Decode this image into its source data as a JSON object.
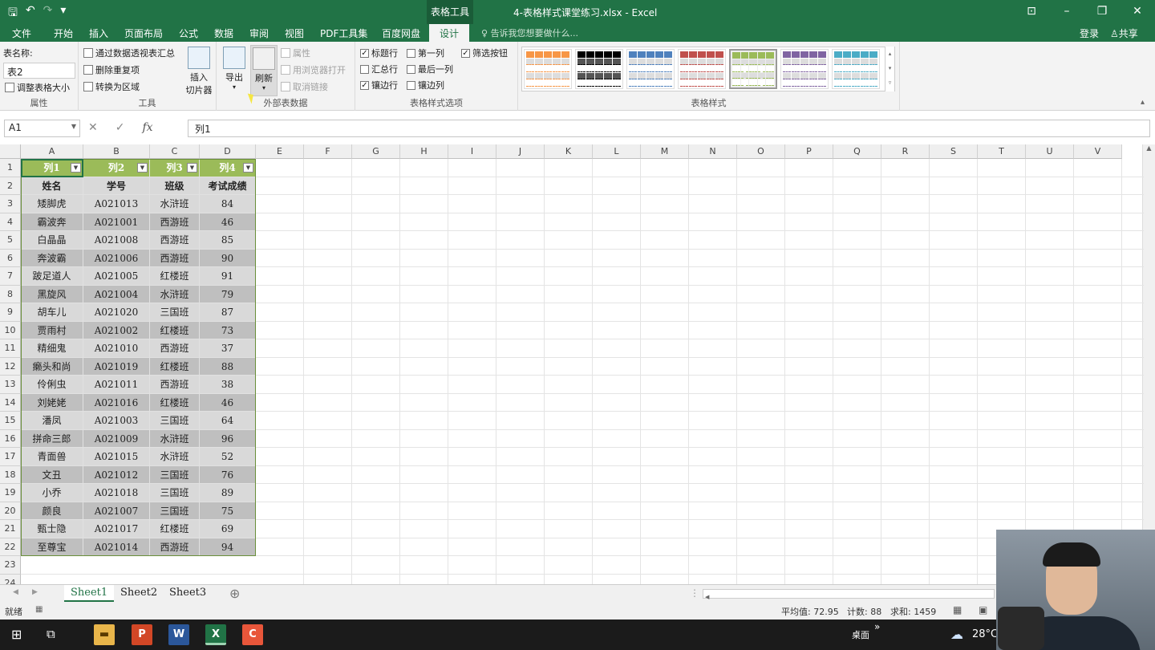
{
  "window": {
    "title": "4-表格样式课堂练习.xlsx - Excel",
    "context_tab_group": "表格工具",
    "qat_undo": "↶",
    "qat_redo": "↷",
    "win_buttons": [
      "⊡",
      "–",
      "❐",
      "✕"
    ]
  },
  "tabs": {
    "items": [
      "文件",
      "开始",
      "插入",
      "页面布局",
      "公式",
      "数据",
      "审阅",
      "视图",
      "PDF工具集",
      "百度网盘",
      "设计"
    ],
    "active": "设计",
    "tell_me": "告诉我您想要做什么...",
    "login": "登录",
    "share": "共享"
  },
  "ribbon": {
    "props": {
      "name_label": "表名称:",
      "name_value": "表2",
      "resize": "调整表格大小",
      "group": "属性"
    },
    "tools": {
      "pivot": "通过数据透视表汇总",
      "dedupe": "删除重复项",
      "convert": "转换为区域",
      "slicer_line1": "插入",
      "slicer_line2": "切片器",
      "group": "工具"
    },
    "external": {
      "export": "导出",
      "refresh": "刷新",
      "properties": "属性",
      "open_browser": "用浏览器打开",
      "unlink": "取消链接",
      "group": "外部表数据"
    },
    "style_options": {
      "header_row": "标题行",
      "total_row": "汇总行",
      "banded_rows": "镶边行",
      "first_col": "第一列",
      "last_col": "最后一列",
      "banded_cols": "镶边列",
      "filter_btn": "筛选按钮",
      "header_row_checked": true,
      "total_row_checked": false,
      "banded_rows_checked": true,
      "first_col_checked": false,
      "last_col_checked": false,
      "banded_cols_checked": false,
      "filter_btn_checked": true,
      "group": "表格样式选项"
    },
    "styles": {
      "group": "表格样式",
      "swatches": [
        "#f79646",
        "#000000",
        "#4f81bd",
        "#c0504d",
        "#9bbb59",
        "#8064a2",
        "#4bacc6"
      ],
      "selected_index": 4
    }
  },
  "formula_bar": {
    "name_box": "A1",
    "cancel": "✕",
    "enter": "✓",
    "fx": "fx",
    "content": "列1"
  },
  "sheet": {
    "columns": [
      "A",
      "B",
      "C",
      "D",
      "E",
      "F",
      "G",
      "H",
      "I",
      "J",
      "K",
      "L",
      "M",
      "N",
      "O",
      "P",
      "Q",
      "R",
      "S",
      "T",
      "U",
      "V"
    ],
    "row_numbers": [
      "1",
      "2",
      "3",
      "4",
      "5",
      "6",
      "7",
      "8",
      "9",
      "10",
      "11",
      "12",
      "13",
      "14",
      "15",
      "16",
      "17",
      "18",
      "19",
      "20",
      "21",
      "22",
      "23",
      "24"
    ],
    "header_row": [
      "列1",
      "列2",
      "列3",
      "列4"
    ],
    "dropdown_glyph": "▼",
    "row2": [
      "姓名",
      "学号",
      "班级",
      "考试成绩"
    ],
    "rows": [
      [
        "矮脚虎",
        "A021013",
        "水浒班",
        "84"
      ],
      [
        "霸波奔",
        "A021001",
        "西游班",
        "46"
      ],
      [
        "白晶晶",
        "A021008",
        "西游班",
        "85"
      ],
      [
        "奔波霸",
        "A021006",
        "西游班",
        "90"
      ],
      [
        "跛足道人",
        "A021005",
        "红楼班",
        "91"
      ],
      [
        "黑旋风",
        "A021004",
        "水浒班",
        "79"
      ],
      [
        "胡车儿",
        "A021020",
        "三国班",
        "87"
      ],
      [
        "贾雨村",
        "A021002",
        "红楼班",
        "73"
      ],
      [
        "精细鬼",
        "A021010",
        "西游班",
        "37"
      ],
      [
        "癞头和尚",
        "A021019",
        "红楼班",
        "88"
      ],
      [
        "伶俐虫",
        "A021011",
        "西游班",
        "38"
      ],
      [
        "刘姥姥",
        "A021016",
        "红楼班",
        "46"
      ],
      [
        "潘凤",
        "A021003",
        "三国班",
        "64"
      ],
      [
        "拼命三郎",
        "A021009",
        "水浒班",
        "96"
      ],
      [
        "青面兽",
        "A021015",
        "水浒班",
        "52"
      ],
      [
        "文丑",
        "A021012",
        "三国班",
        "76"
      ],
      [
        "小乔",
        "A021018",
        "三国班",
        "89"
      ],
      [
        "颜良",
        "A021007",
        "三国班",
        "75"
      ],
      [
        "甄士隐",
        "A021017",
        "红楼班",
        "69"
      ],
      [
        "至尊宝",
        "A021014",
        "西游班",
        "94"
      ]
    ]
  },
  "sheet_tabs": {
    "items": [
      "Sheet1",
      "Sheet2",
      "Sheet3"
    ],
    "active": "Sheet1",
    "add": "⊕"
  },
  "status": {
    "ready": "就绪",
    "average": "平均值: 72.95",
    "count": "计数: 88",
    "sum": "求和: 1459"
  },
  "taskbar": {
    "desktop": "桌面",
    "chevron": "»",
    "temp": "28°C",
    "apps": [
      "file-explorer",
      "powerpoint",
      "word",
      "excel",
      "app-orange"
    ]
  }
}
